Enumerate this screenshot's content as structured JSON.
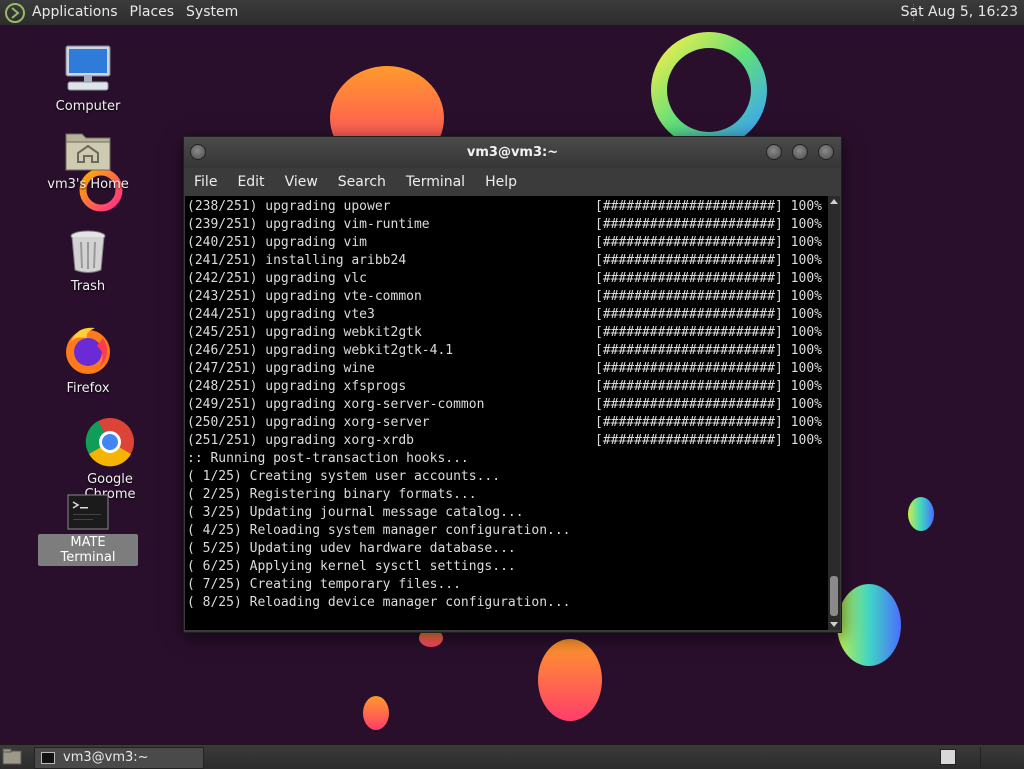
{
  "top_panel": {
    "menus": [
      "Applications",
      "Places",
      "System"
    ],
    "clock": "Sat Aug  5, 16:23"
  },
  "desktop_icons": [
    {
      "label": "Computer",
      "icon": "computer-icon"
    },
    {
      "label": "vm3's Home",
      "icon": "home-folder-icon"
    },
    {
      "label": "Trash",
      "icon": "trash-icon"
    },
    {
      "label": "Firefox",
      "icon": "firefox-icon"
    },
    {
      "label": "Google Chrome",
      "icon": "chrome-icon"
    },
    {
      "label": "MATE Terminal",
      "icon": "terminal-icon"
    }
  ],
  "terminal": {
    "title": "vm3@vm3:~",
    "menus": [
      "File",
      "Edit",
      "View",
      "Search",
      "Terminal",
      "Help"
    ],
    "progress_bar": "[######################]",
    "progress_pct": "100%",
    "packages": [
      {
        "counter": "(238/251)",
        "action": "upgrading",
        "name": "upower"
      },
      {
        "counter": "(239/251)",
        "action": "upgrading",
        "name": "vim-runtime"
      },
      {
        "counter": "(240/251)",
        "action": "upgrading",
        "name": "vim"
      },
      {
        "counter": "(241/251)",
        "action": "installing",
        "name": "aribb24"
      },
      {
        "counter": "(242/251)",
        "action": "upgrading",
        "name": "vlc"
      },
      {
        "counter": "(243/251)",
        "action": "upgrading",
        "name": "vte-common"
      },
      {
        "counter": "(244/251)",
        "action": "upgrading",
        "name": "vte3"
      },
      {
        "counter": "(245/251)",
        "action": "upgrading",
        "name": "webkit2gtk"
      },
      {
        "counter": "(246/251)",
        "action": "upgrading",
        "name": "webkit2gtk-4.1"
      },
      {
        "counter": "(247/251)",
        "action": "upgrading",
        "name": "wine"
      },
      {
        "counter": "(248/251)",
        "action": "upgrading",
        "name": "xfsprogs"
      },
      {
        "counter": "(249/251)",
        "action": "upgrading",
        "name": "xorg-server-common"
      },
      {
        "counter": "(250/251)",
        "action": "upgrading",
        "name": "xorg-server"
      },
      {
        "counter": "(251/251)",
        "action": "upgrading",
        "name": "xorg-xrdb"
      }
    ],
    "hooks_header": ":: Running post-transaction hooks...",
    "hooks": [
      "( 1/25) Creating system user accounts...",
      "( 2/25) Registering binary formats...",
      "( 3/25) Updating journal message catalog...",
      "( 4/25) Reloading system manager configuration...",
      "( 5/25) Updating udev hardware database...",
      "( 6/25) Applying kernel sysctl settings...",
      "( 7/25) Creating temporary files...",
      "( 8/25) Reloading device manager configuration..."
    ]
  },
  "taskbar": {
    "window_button": "vm3@vm3:~"
  }
}
